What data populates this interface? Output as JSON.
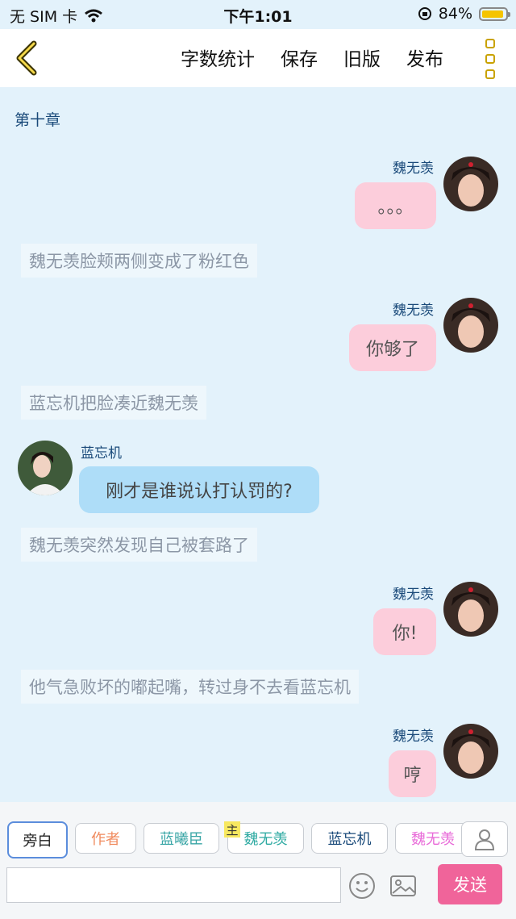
{
  "status_bar": {
    "carrier": "无 SIM 卡",
    "time": "下午1:01",
    "battery": "84%"
  },
  "toolbar": {
    "items": [
      "字数统计",
      "保存",
      "旧版",
      "发布"
    ]
  },
  "chapter_title": "第十章",
  "messages": [
    {
      "speaker": "魏无羡",
      "text": "。。。"
    },
    {
      "narration": "魏无羡脸颊两侧变成了粉红色"
    },
    {
      "speaker": "魏无羡",
      "text": "你够了"
    },
    {
      "narration": "蓝忘机把脸凑近魏无羡"
    },
    {
      "speaker": "蓝忘机",
      "text": "刚才是谁说认打认罚的?"
    },
    {
      "narration": "魏无羡突然发现自己被套路了"
    },
    {
      "speaker": "魏无羡",
      "text": "你!"
    },
    {
      "narration": "他气急败坏的嘟起嘴，转过身不去看蓝忘机"
    },
    {
      "speaker": "魏无羡",
      "text": "哼"
    }
  ],
  "roles": [
    {
      "label": "旁白",
      "color": "#222222"
    },
    {
      "label": "作者",
      "color": "#f08a5d"
    },
    {
      "label": "蓝曦臣",
      "color": "#3aa6a6"
    },
    {
      "label": "魏无羡",
      "color": "#2eaaa2"
    },
    {
      "label": "蓝忘机",
      "color": "#1a4a7a"
    },
    {
      "label": "魏无羡",
      "color": "#e86ad8"
    }
  ],
  "owner_tag": "主",
  "input": {
    "value": "",
    "placeholder": ""
  },
  "send_label": "发送",
  "colors": {
    "background": "#e3f2fb",
    "pink_bubble": "#fccddb",
    "blue_bubble": "#aeddf8",
    "send": "#f0649a"
  }
}
